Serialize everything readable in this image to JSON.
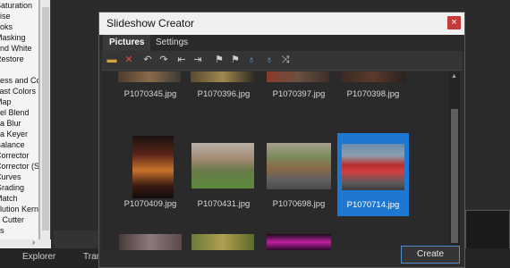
{
  "background": {
    "effects_list": [
      "Saturation",
      "oise",
      "ooks",
      "Masking",
      "and White",
      "Restore",
      "r",
      "ness and Co",
      "cast Colors",
      "Map",
      "nel Blend",
      "na Blur",
      "na Keyer",
      "Balance",
      "Corrector",
      "Corrector (S",
      "Curves",
      "Grading",
      "Match",
      "olution Kerne",
      "e Cutter",
      "us"
    ],
    "tabs": [
      "Explorer",
      "Tran"
    ]
  },
  "dialog": {
    "title": "Slideshow Creator",
    "close_label": "×",
    "tabs": [
      {
        "label": "Pictures"
      },
      {
        "label": "Settings"
      }
    ],
    "toolbar_icons": [
      "folder-icon",
      "delete-icon",
      "rotate-left-icon",
      "rotate-right-icon",
      "move-first-icon",
      "move-last-icon",
      "marker-1-icon",
      "marker-2-icon",
      "marker-3-icon",
      "marker-4-icon",
      "shuffle-icon"
    ],
    "pictures": [
      {
        "name": "P1070345.jpg",
        "selected": false
      },
      {
        "name": "P1070396.jpg",
        "selected": false
      },
      {
        "name": "P1070397.jpg",
        "selected": false
      },
      {
        "name": "P1070398.jpg",
        "selected": false
      },
      {
        "name": "P1070409.jpg",
        "selected": false
      },
      {
        "name": "P1070431.jpg",
        "selected": false
      },
      {
        "name": "P1070698.jpg",
        "selected": false
      },
      {
        "name": "P1070714.jpg",
        "selected": true
      }
    ],
    "create_label": "Create"
  }
}
